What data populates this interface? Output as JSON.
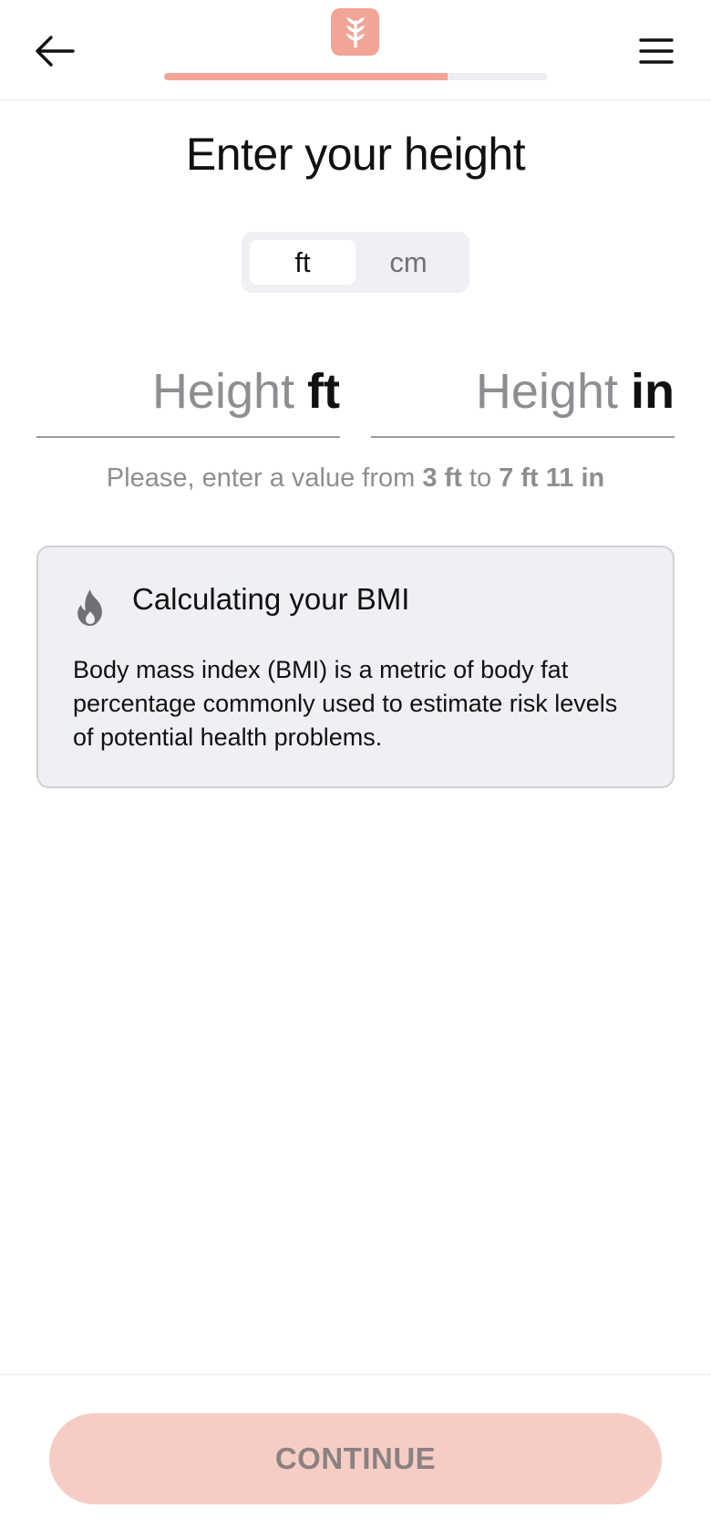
{
  "colors": {
    "accent": "#f2a497",
    "button_disabled_bg": "#f6cdc5",
    "progress_track": "#eeeef2",
    "card_bg": "#eff0f3"
  },
  "header": {
    "back_icon": "arrow-left-icon",
    "logo_icon": "leaf-logo-icon",
    "menu_icon": "hamburger-menu-icon",
    "progress": 0.74
  },
  "page": {
    "title": "Enter your height"
  },
  "unit_toggle": {
    "options": [
      "ft",
      "cm"
    ],
    "selected": "ft"
  },
  "inputs": {
    "feet": {
      "placeholder": "Height",
      "value": "",
      "unit": "ft"
    },
    "inches": {
      "placeholder": "Height",
      "value": "",
      "unit": "in"
    }
  },
  "hint": {
    "prefix": "Please, enter a value from ",
    "min": "3 ft",
    "middle": " to ",
    "max": "7 ft 11 in"
  },
  "info_card": {
    "icon": "flame-icon",
    "title": "Calculating your BMI",
    "text": "Body mass index (BMI) is a metric of body fat percentage commonly used to estimate risk levels of potential health problems."
  },
  "footer": {
    "continue_label": "CONTINUE",
    "continue_disabled": true
  }
}
